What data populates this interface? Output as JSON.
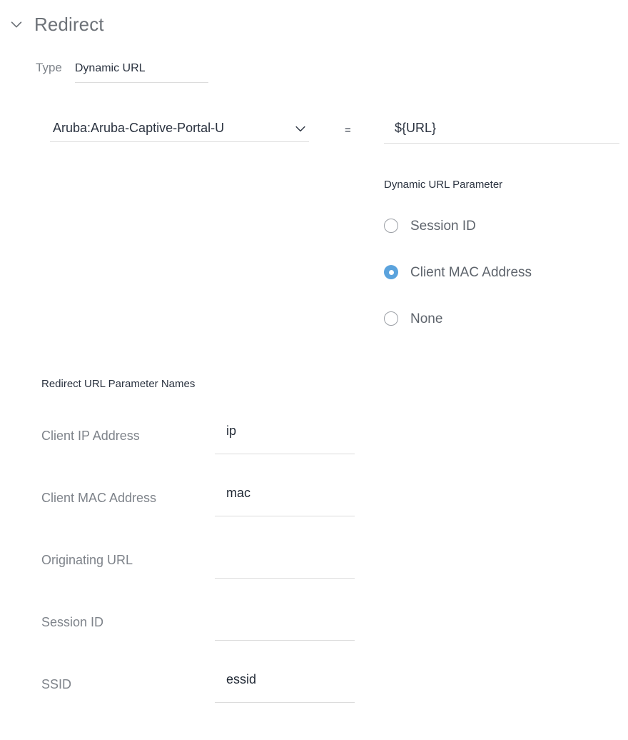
{
  "section": {
    "title": "Redirect",
    "collapse_icon": "chevron-down-icon",
    "expanded": true
  },
  "type_row": {
    "label": "Type",
    "value": "Dynamic URL"
  },
  "mapping": {
    "attribute_select": {
      "value": "Aruba:Aruba-Captive-Portal-U",
      "caret_icon": "chevron-down-icon"
    },
    "operator": "=",
    "url_value": "${URL}"
  },
  "dynamic_url_parameter": {
    "label": "Dynamic URL Parameter",
    "selected": "Client MAC Address",
    "accent_color": "#5ba3dd",
    "options": [
      {
        "label": "Session ID",
        "checked": false
      },
      {
        "label": "Client MAC Address",
        "checked": true
      },
      {
        "label": "None",
        "checked": false
      }
    ]
  },
  "redirect_url_parameter_names": {
    "title": "Redirect URL Parameter Names",
    "rows": [
      {
        "label": "Client IP Address",
        "value": "ip"
      },
      {
        "label": "Client MAC Address",
        "value": "mac"
      },
      {
        "label": "Originating URL",
        "value": ""
      },
      {
        "label": "Session ID",
        "value": ""
      },
      {
        "label": "SSID",
        "value": "essid"
      }
    ]
  }
}
